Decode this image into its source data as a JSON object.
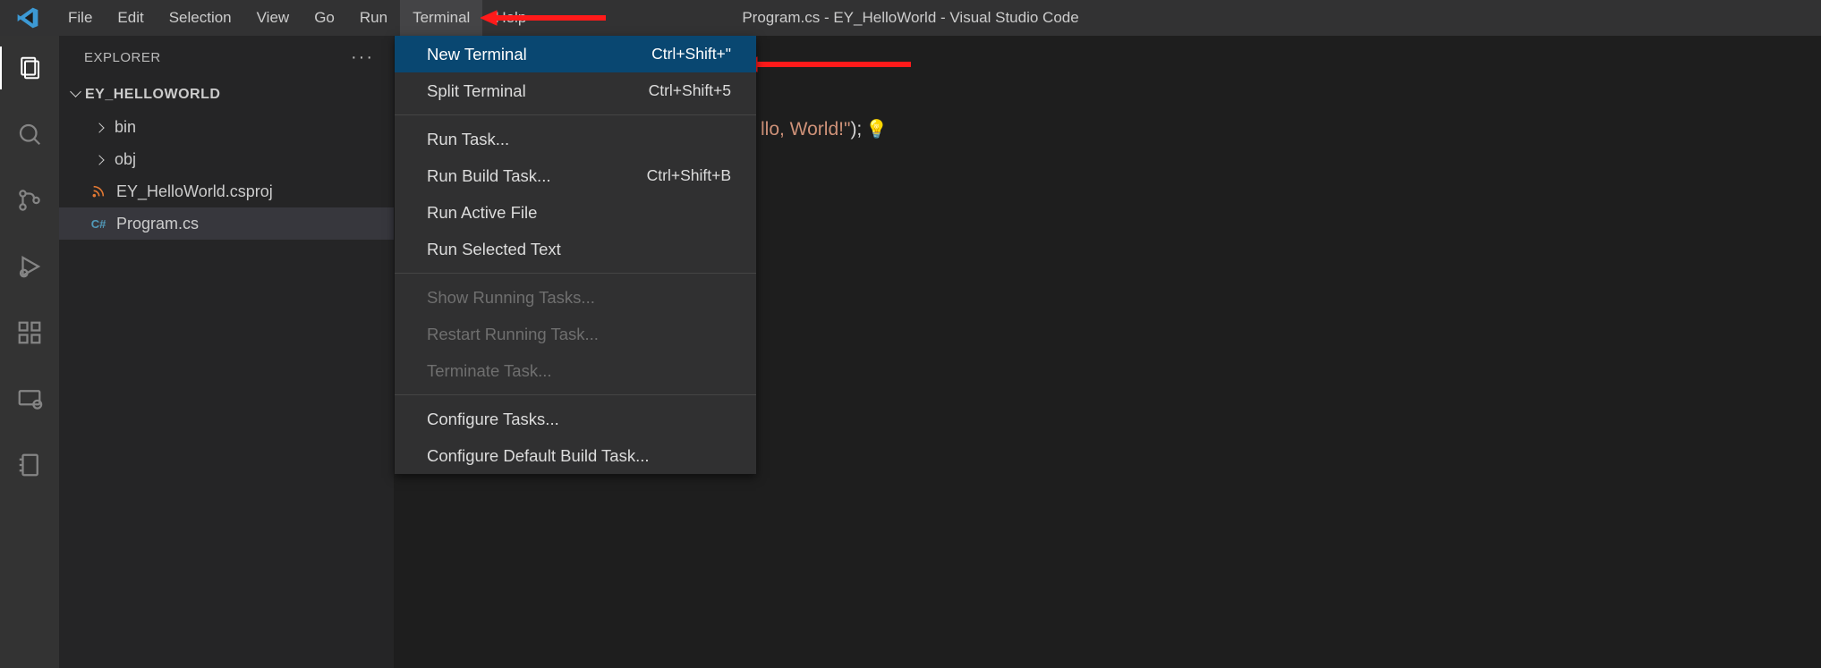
{
  "titlebar": {
    "menus": [
      "File",
      "Edit",
      "Selection",
      "View",
      "Go",
      "Run",
      "Terminal",
      "Help"
    ],
    "active_menu_index": 6,
    "window_title": "Program.cs - EY_HelloWorld - Visual Studio Code"
  },
  "activitybar": {
    "items": [
      "explorer-icon",
      "search-icon",
      "source-control-icon",
      "run-debug-icon",
      "extensions-icon",
      "remote-icon",
      "notebook-icon"
    ],
    "active_index": 0
  },
  "explorer": {
    "title": "EXPLORER",
    "more_label": "···",
    "root": "EY_HELLOWORLD",
    "items": [
      {
        "kind": "folder",
        "name": "bin"
      },
      {
        "kind": "folder",
        "name": "obj"
      },
      {
        "kind": "file",
        "name": "EY_HelloWorld.csproj",
        "icon": "rss-icon",
        "color": "#e37933"
      },
      {
        "kind": "file",
        "name": "Program.cs",
        "icon": "csharp-icon",
        "color": "#519aba",
        "selected": true
      }
    ]
  },
  "dropdown": {
    "groups": [
      [
        {
          "label": "New Terminal",
          "shortcut": "Ctrl+Shift+\"",
          "highlight": true
        },
        {
          "label": "Split Terminal",
          "shortcut": "Ctrl+Shift+5"
        }
      ],
      [
        {
          "label": "Run Task..."
        },
        {
          "label": "Run Build Task...",
          "shortcut": "Ctrl+Shift+B"
        },
        {
          "label": "Run Active File"
        },
        {
          "label": "Run Selected Text"
        }
      ],
      [
        {
          "label": "Show Running Tasks...",
          "disabled": true
        },
        {
          "label": "Restart Running Task...",
          "disabled": true
        },
        {
          "label": "Terminate Task...",
          "disabled": true
        }
      ],
      [
        {
          "label": "Configure Tasks..."
        },
        {
          "label": "Configure Default Build Task..."
        }
      ]
    ]
  },
  "editor": {
    "code_fragment_string": "llo, World!\"",
    "code_fragment_tail": ");"
  }
}
